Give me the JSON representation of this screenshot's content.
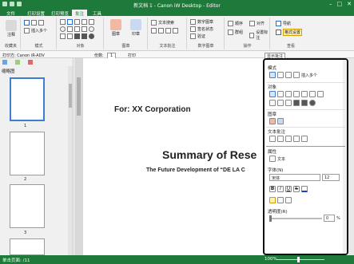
{
  "window": {
    "title": "新文档 1 - Canon iW Desktop - Editor"
  },
  "tabs": [
    "文件",
    "打印设置",
    "打印预览",
    "批注",
    "工具"
  ],
  "active_tab": "批注",
  "ribbon": {
    "groups": [
      "收藏夹",
      "模式",
      "对象",
      "图章",
      "文本批注",
      "数字图章",
      "操作",
      "查看"
    ],
    "buttons": {
      "annotate": "注释",
      "insert_object": "插入多个",
      "stamp": "图章",
      "stamp2": "印章",
      "text_search": "文本搜索",
      "digital_stamp_show": "数字图章",
      "verify_state": "签名状态",
      "verify": "验证",
      "order": "顺序",
      "group": "群组",
      "align": "对齐",
      "align2": "设置标注",
      "nav": "导航",
      "attr_window": "格式设置",
      "show_annotation": "显示批注"
    }
  },
  "addressbar": {
    "printer": "打印方: Canon iR-ADV",
    "copies_label": "份数:",
    "copies_value": "1",
    "print_label": "打印",
    "show_annotation": "显示批注"
  },
  "leftpane": {
    "title": "缩略图",
    "pages": [
      "1",
      "2",
      "3"
    ]
  },
  "document": {
    "for_line": "For: XX Corporation",
    "summary": "Summary of Rese",
    "future": "The Future Development of “DE LA C"
  },
  "rightpanel": {
    "mode_label": "模式",
    "insert_multiple": "插入多个",
    "objects_label": "对象",
    "stamp_label": "图章",
    "text_annot_label": "文本批注",
    "properties_label": "属性",
    "property_type": "文本",
    "font_label": "字体(N)",
    "font_value": "宋体",
    "size_value": "12",
    "transparency_label": "透明度(R)",
    "transparency_value": "0",
    "percent": "%"
  },
  "status": {
    "page_info": "单击页面: /11",
    "zoom": "100%"
  },
  "colors": {
    "accent": "#1e7a3a",
    "selection": "#3b7fd4"
  }
}
